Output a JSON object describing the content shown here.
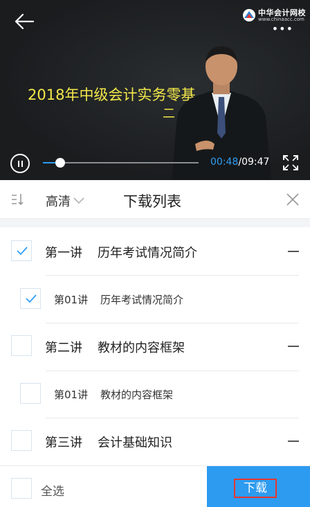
{
  "video": {
    "course_title": "2018年中级会计实务零基",
    "course_subtitle": "二",
    "logo_name": "中华会计网校",
    "logo_url": "www.chinaacc.com",
    "current_time": "00:48",
    "total_time": "09:47",
    "progress_fraction": 0.11
  },
  "download_panel": {
    "quality_label": "高清",
    "title": "下载列表"
  },
  "lectures": [
    {
      "kind": "lecture",
      "number": "第一讲",
      "name": "历年考试情况简介",
      "checked": true
    },
    {
      "kind": "sub",
      "number": "第01讲",
      "name": "历年考试情况简介",
      "checked": true
    },
    {
      "kind": "lecture",
      "number": "第二讲",
      "name": "教材的内容框架",
      "checked": false
    },
    {
      "kind": "sub",
      "number": "第01讲",
      "name": "教材的内容框架",
      "checked": false
    },
    {
      "kind": "lecture",
      "number": "第三讲",
      "name": "会计基础知识",
      "checked": false
    }
  ],
  "bottom_bar": {
    "select_all_label": "全选",
    "download_label": "下载"
  },
  "colors": {
    "accent": "#2d9bf0",
    "check": "#2e9ef3",
    "highlight_border": "#e8362f",
    "title_yellow": "#f4e84a"
  },
  "icons": [
    "back-arrow-icon",
    "logo-icon",
    "more-icon",
    "pause-icon",
    "fullscreen-icon",
    "list-icon",
    "chevron-down-icon",
    "close-icon",
    "checkmark-icon",
    "collapse-icon"
  ]
}
